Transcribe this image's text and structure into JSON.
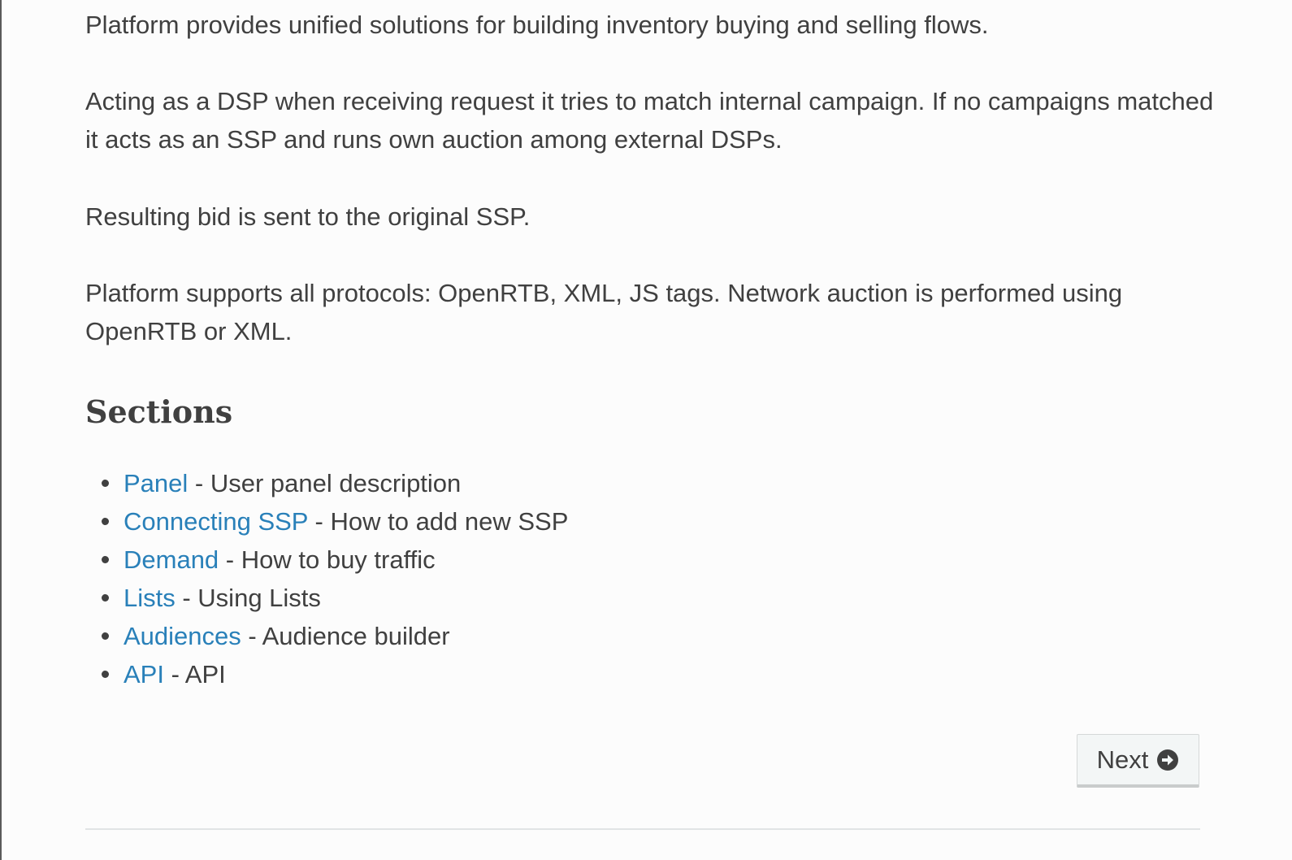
{
  "intro": {
    "p1": "Platform provides unified solutions for building inventory buying and selling flows.",
    "p2": "Acting as a DSP when receiving request it tries to match internal campaign. If no campaigns matched it acts as an SSP and runs own auction among external DSPs.",
    "p3": "Resulting bid is sent to the original SSP.",
    "p4": "Platform supports all protocols: OpenRTB, XML, JS tags. Network auction is performed using OpenRTB or XML."
  },
  "sections": {
    "heading": "Sections",
    "items": [
      {
        "link": "Panel",
        "desc": " - User panel description"
      },
      {
        "link": "Connecting SSP",
        "desc": " - How to add new SSP"
      },
      {
        "link": "Demand",
        "desc": " - How to buy traffic"
      },
      {
        "link": "Lists",
        "desc": " - Using Lists"
      },
      {
        "link": "Audiences",
        "desc": " - Audience builder"
      },
      {
        "link": "API",
        "desc": " - API"
      }
    ]
  },
  "navigation": {
    "next_label": "Next",
    "next_icon": "arrow-circle-right-icon"
  },
  "colors": {
    "link": "#2980b9",
    "text": "#404040",
    "background": "#fcfcfc"
  }
}
